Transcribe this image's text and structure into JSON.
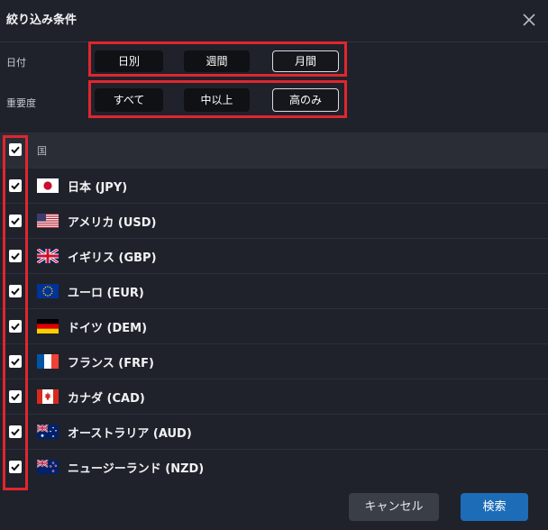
{
  "dialog": {
    "title": "絞り込み条件"
  },
  "filters": {
    "date": {
      "label": "日付",
      "options": [
        "日別",
        "週間",
        "月間"
      ],
      "selected": "月間"
    },
    "importance": {
      "label": "重要度",
      "options": [
        "すべて",
        "中以上",
        "高のみ"
      ],
      "selected": "高のみ"
    }
  },
  "country_list": {
    "header_label": "国",
    "header_checked": true,
    "items": [
      {
        "label": "日本 (JPY)",
        "checked": true,
        "flag": "japan-flag-icon"
      },
      {
        "label": "アメリカ (USD)",
        "checked": true,
        "flag": "usa-flag-icon"
      },
      {
        "label": "イギリス (GBP)",
        "checked": true,
        "flag": "uk-flag-icon"
      },
      {
        "label": "ユーロ (EUR)",
        "checked": true,
        "flag": "eu-flag-icon"
      },
      {
        "label": "ドイツ (DEM)",
        "checked": true,
        "flag": "germany-flag-icon"
      },
      {
        "label": "フランス (FRF)",
        "checked": true,
        "flag": "france-flag-icon"
      },
      {
        "label": "カナダ (CAD)",
        "checked": true,
        "flag": "canada-flag-icon"
      },
      {
        "label": "オーストラリア (AUD)",
        "checked": true,
        "flag": "australia-flag-icon"
      },
      {
        "label": "ニュージーランド (NZD)",
        "checked": true,
        "flag": "new-zealand-flag-icon"
      }
    ]
  },
  "actions": {
    "cancel_label": "キャンセル",
    "search_label": "検索"
  },
  "colors": {
    "background": "#1f222a",
    "highlight_frame": "#e0262f",
    "primary_button": "#1c6cb8",
    "segment_button": "#0f1115"
  }
}
